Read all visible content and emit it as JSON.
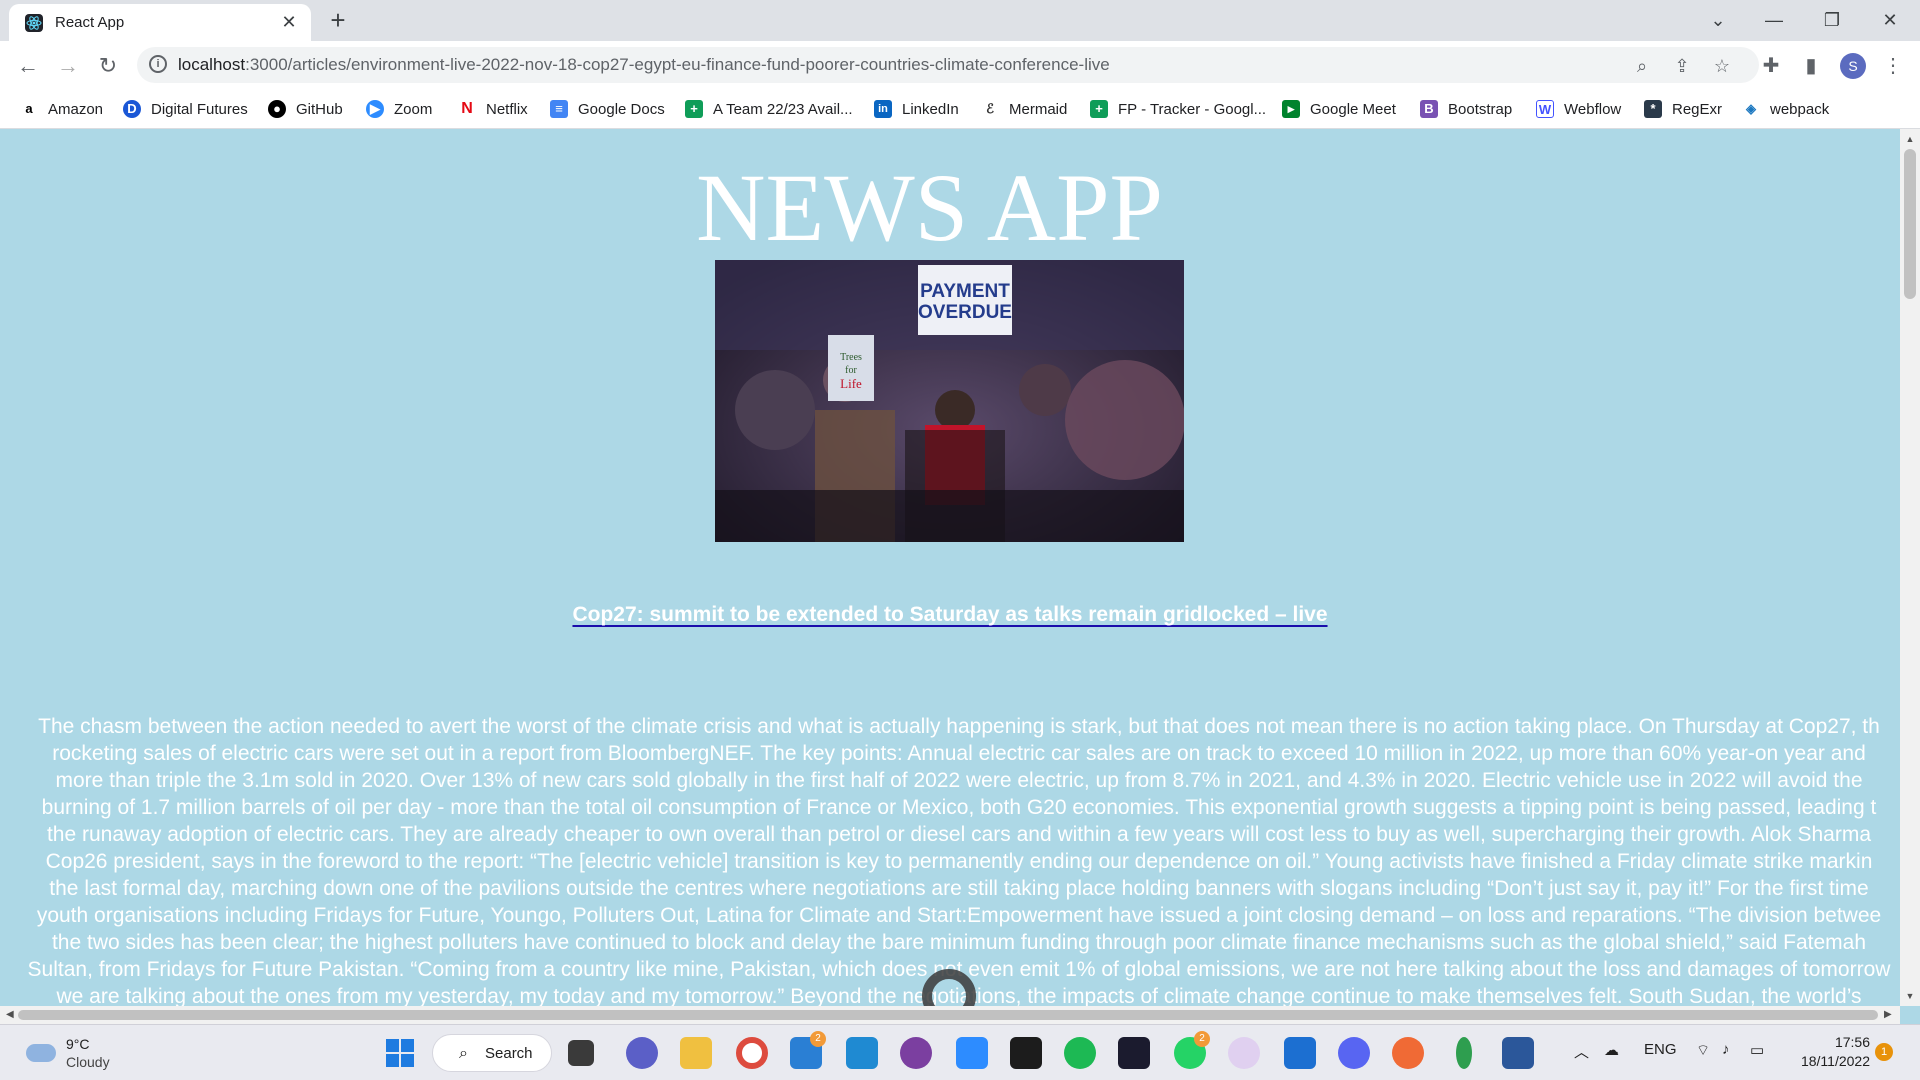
{
  "browser": {
    "tab_title": "React App",
    "url_host": "localhost",
    "url_rest": ":3000/articles/environment-live-2022-nov-18-cop27-egypt-eu-finance-fund-poorer-countries-climate-conference-live",
    "profile_initial": "S"
  },
  "bookmarks": [
    {
      "label": "Amazon",
      "icon": "amazon-icon",
      "color": "#000000"
    },
    {
      "label": "Digital Futures",
      "icon": "digital-futures-icon",
      "color": "#1a57d6"
    },
    {
      "label": "GitHub",
      "icon": "github-icon",
      "color": "#000000"
    },
    {
      "label": "Zoom",
      "icon": "zoom-icon",
      "color": "#2d8cff"
    },
    {
      "label": "Netflix",
      "icon": "netflix-icon",
      "color": "#e50914"
    },
    {
      "label": "Google Docs",
      "icon": "google-docs-icon",
      "color": "#4285f4"
    },
    {
      "label": "A Team 22/23 Avail...",
      "icon": "google-sheets-icon",
      "color": "#0f9d58"
    },
    {
      "label": "LinkedIn",
      "icon": "linkedin-icon",
      "color": "#0a66c2"
    },
    {
      "label": "Mermaid",
      "icon": "mermaid-icon",
      "color": "#333333"
    },
    {
      "label": "FP - Tracker - Googl...",
      "icon": "google-sheets-icon",
      "color": "#0f9d58"
    },
    {
      "label": "Google Meet",
      "icon": "google-meet-icon",
      "color": "#00832d"
    },
    {
      "label": "Bootstrap",
      "icon": "bootstrap-icon",
      "color": "#7952b3"
    },
    {
      "label": "Webflow",
      "icon": "webflow-icon",
      "color": "#4353ff"
    },
    {
      "label": "RegExr",
      "icon": "regexr-icon",
      "color": "#2a3a4a"
    },
    {
      "label": "webpack",
      "icon": "webpack-icon",
      "color": "#1c78c0"
    }
  ],
  "page": {
    "app_title": "NEWS APP",
    "hero_sign": [
      "PAYMENT",
      "OVERDUE"
    ],
    "hero_small_sign": [
      "Trees",
      "for",
      "Life"
    ],
    "article_title": "Cop27: summit to be extended to Saturday as talks remain gridlocked – live",
    "body_lines": [
      "The chasm between the action needed to avert the worst of the climate crisis and what is actually happening is stark, but that does not mean there is no action taking place. On Thursday at Cop27, th",
      "rocketing sales of electric cars were set out in a report from BloombergNEF. The key points: Annual electric car sales are on track to exceed 10 million in 2022, up more than 60% year-on year and",
      "more than triple the 3.1m sold in 2020. Over 13% of new cars sold globally in the first half of 2022 were electric, up from 8.7% in 2021, and 4.3% in 2020. Electric vehicle use in 2022 will avoid the",
      "burning of 1.7 million barrels of oil per day - more than the total oil consumption of France or Mexico, both G20 economies. This exponential growth suggests a tipping point is being passed, leading t",
      "the runaway adoption of electric cars. They are already cheaper to own overall than petrol or diesel cars and within a few years will cost less to buy as well, supercharging their growth. Alok Sharma",
      "Cop26 president, says in the foreword to the report: “The [electric vehicle] transition is key to permanently ending our dependence on oil.” Young activists have finished a Friday climate strike markin",
      "the last formal day, marching down one of the pavilions outside the centres where negotiations are still taking place holding banners with slogans including “Don’t just say it, pay it!” For the first time",
      "youth organisations including Fridays for Future, Youngo, Polluters Out, Latina for Climate and Start:Empowerment have issued a joint closing demand – on loss and reparations. “The division betwee",
      "the two sides has been clear; the highest polluters have continued to block and delay the bare minimum funding through poor climate finance mechanisms such as the global shield,” said Fatemah",
      "Sultan, from Fridays for Future Pakistan. “Coming from a country like mine, Pakistan, which does not even emit 1% of global emissions, we are not here talking about the loss and damages of tomorrow",
      "we are talking about the ones from my yesterday, my today and my tomorrow.” Beyond the negotiations, the impacts of climate change continue to make themselves felt. South Sudan, the world’s"
    ]
  },
  "taskbar": {
    "temperature": "9°C",
    "condition": "Cloudy",
    "search_label": "Search",
    "mail_badge": "2",
    "whatsapp_badge": "2",
    "language": "ENG",
    "time": "17:56",
    "date": "18/11/2022",
    "notification_count": "1"
  }
}
